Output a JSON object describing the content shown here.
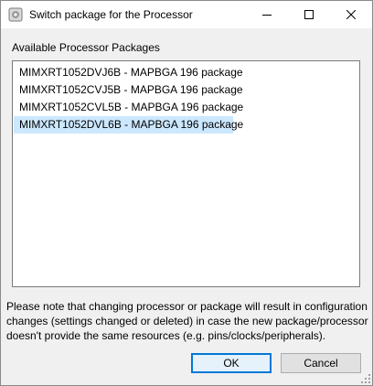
{
  "window": {
    "title": "Switch package for the Processor",
    "icon": "dialog-gear-icon",
    "controls": [
      "minimize-icon",
      "maximize-icon",
      "close-icon"
    ]
  },
  "packages": {
    "label": "Available Processor Packages",
    "items": [
      {
        "label": "MIMXRT1052DVJ6B - MAPBGA 196 package",
        "selected": false
      },
      {
        "label": "MIMXRT1052CVJ5B - MAPBGA 196 package",
        "selected": false
      },
      {
        "label": "MIMXRT1052CVL5B - MAPBGA 196 package",
        "selected": false
      },
      {
        "label": "MIMXRT1052DVL6B - MAPBGA 196 package",
        "selected": true
      }
    ]
  },
  "note": {
    "text": "Please note that changing processor or package will result in configuration changes (settings changed or deleted) in case the new package/processor doesn't provide the same resources (e.g. pins/clocks/peripherals)."
  },
  "buttons": {
    "ok_label": "OK",
    "cancel_label": "Cancel"
  },
  "colors": {
    "selection": "#cce8ff",
    "default_button_border": "#0078d7"
  }
}
